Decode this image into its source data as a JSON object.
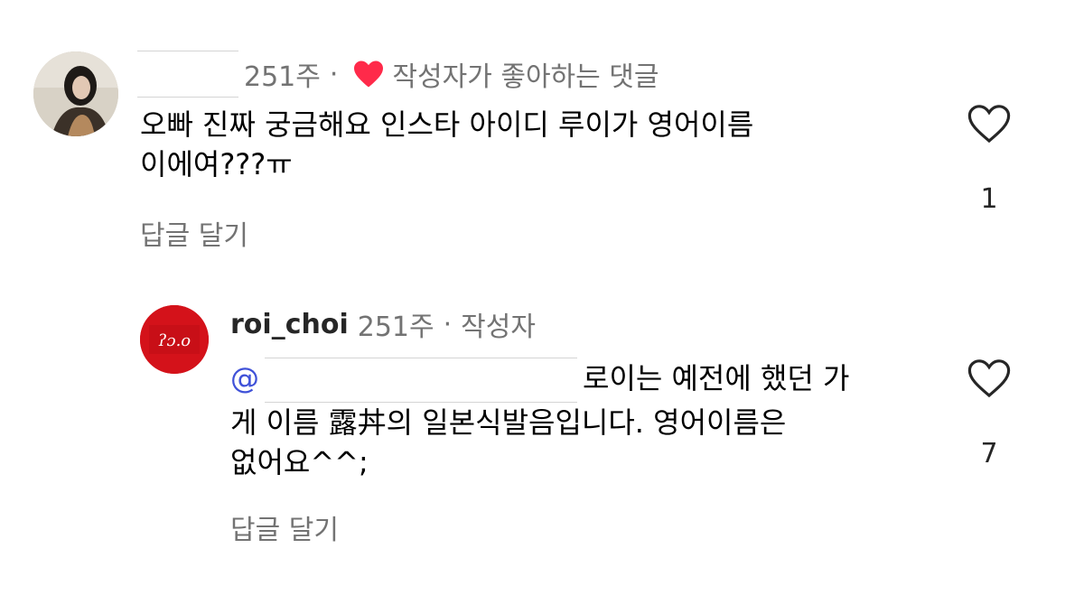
{
  "comments": [
    {
      "meta_time": "251주",
      "meta_sep": "·",
      "liked_by_author_text": "작성자가 좋아하는 댓글",
      "body_line1": "오빠 진짜 궁금해요 인스타 아이디 루이가 영어이름",
      "body_line2": "이에여???ㅠ",
      "reply_label": "답글 달기",
      "like_count": "1"
    }
  ],
  "reply": {
    "username": "roi_choi",
    "meta_time": "251주",
    "meta_sep": "·",
    "author_tag": "작성자",
    "avatar_text": "ʔɔ.o",
    "mention_prefix": "@",
    "body_line1_suffix": "로이는 예전에 했던 가",
    "body_line2": "게 이름 露丼의 일본식발음입니다. 영어이름은",
    "body_line3": "없어요^^;",
    "reply_label": "답글 달기",
    "like_count": "7"
  },
  "colors": {
    "heart_red": "#ff2a4a",
    "secondary_text": "#737373",
    "mention_blue": "#3f51d8",
    "avatar_red": "#d4121a"
  }
}
